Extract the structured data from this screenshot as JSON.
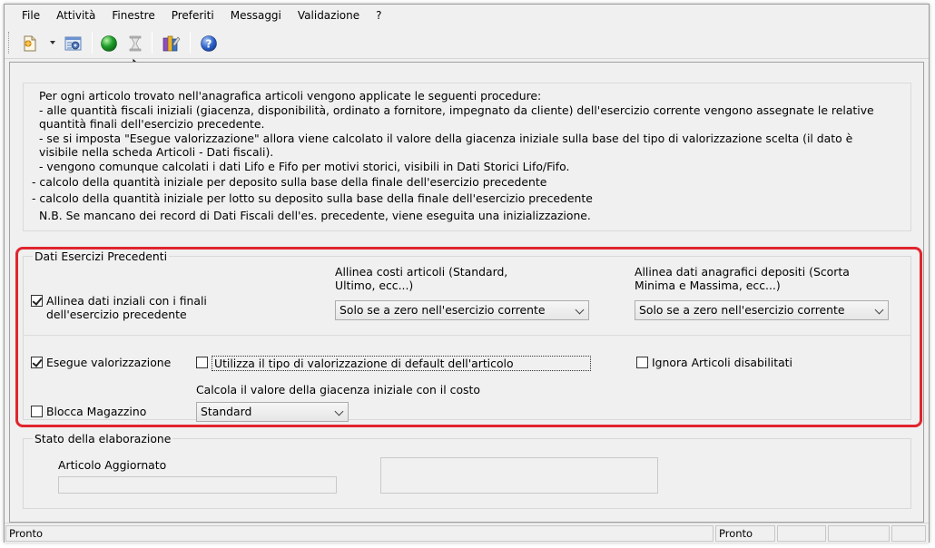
{
  "menu": [
    "File",
    "Attività",
    "Finestre",
    "Preferiti",
    "Messaggi",
    "Validazione",
    "?"
  ],
  "toolbar": {
    "icons": [
      "new-document-icon",
      "dropdown-arrow-icon",
      "gear-settings-icon",
      "green-run-icon",
      "hourglass-icon",
      "books-icon",
      "help-icon"
    ],
    "colors": {
      "run": "#1e9e2a",
      "help": "#2a5fc8"
    }
  },
  "info": {
    "lines": [
      "Per ogni articolo trovato nell'anagrafica articoli vengono applicate le seguenti procedure:",
      "- alle quantità fiscali iniziali (giacenza, disponibilità, ordinato a fornitore, impegnato da cliente) dell'esercizio corrente vengono assegnate le relative",
      "quantità finali dell'esercizio precedente.",
      "- se si imposta \"Esegue valorizzazione\" allora viene calcolato il valore della giacenza iniziale sulla base del tipo di valorizzazione scelta (il dato è",
      "visibile nella scheda Articoli - Dati fiscali).",
      "- vengono comunque calcolati i dati Lifo e Fifo per motivi storici, visibili in Dati Storici Lifo/Fifo.",
      "- calcolo della quantità iniziale per deposito sulla base della finale dell'esercizio precedente",
      "- calcolo della quantità iniziale per lotto su deposito sulla base della finale dell'esercizio precedente",
      "N.B. Se mancano dei record di Dati Fiscali dell'es. precedente, viene eseguita una inizializzazione."
    ]
  },
  "dati_esercizi": {
    "title": "Dati Esercizi Precedenti",
    "allinea_dati": {
      "label_1": "Allinea dati inziali con i finali",
      "label_2": "dell'esercizio precedente",
      "checked": true
    },
    "costi": {
      "label_1": "Allinea costi articoli (Standard,",
      "label_2": "Ultimo, ecc...)",
      "value": "Solo se a zero nell'esercizio corrente"
    },
    "depositi": {
      "label_1": "Allinea dati anagrafici depositi (Scorta",
      "label_2": "Minima e Massima, ecc...)",
      "value": "Solo se a zero nell'esercizio corrente"
    },
    "esegue_valorizzazione": {
      "label": "Esegue valorizzazione",
      "checked": true
    },
    "utilizza_tipo": {
      "label": "Utilizza il tipo di valorizzazione di default dell'articolo",
      "checked": false
    },
    "ignora_articoli": {
      "label": "Ignora Articoli disabilitati",
      "checked": false
    },
    "calcola_label": "Calcola il valore della giacenza iniziale con il costo",
    "costo_value": "Standard",
    "blocca_magazzino": {
      "label": "Blocca Magazzino",
      "checked": false
    },
    "highlight_color": "#e0252e"
  },
  "stato": {
    "title": "Stato della elaborazione",
    "articolo_label": "Articolo Aggiornato",
    "articolo_value": ""
  },
  "status": {
    "left": "Pronto",
    "right": "Pronto"
  }
}
